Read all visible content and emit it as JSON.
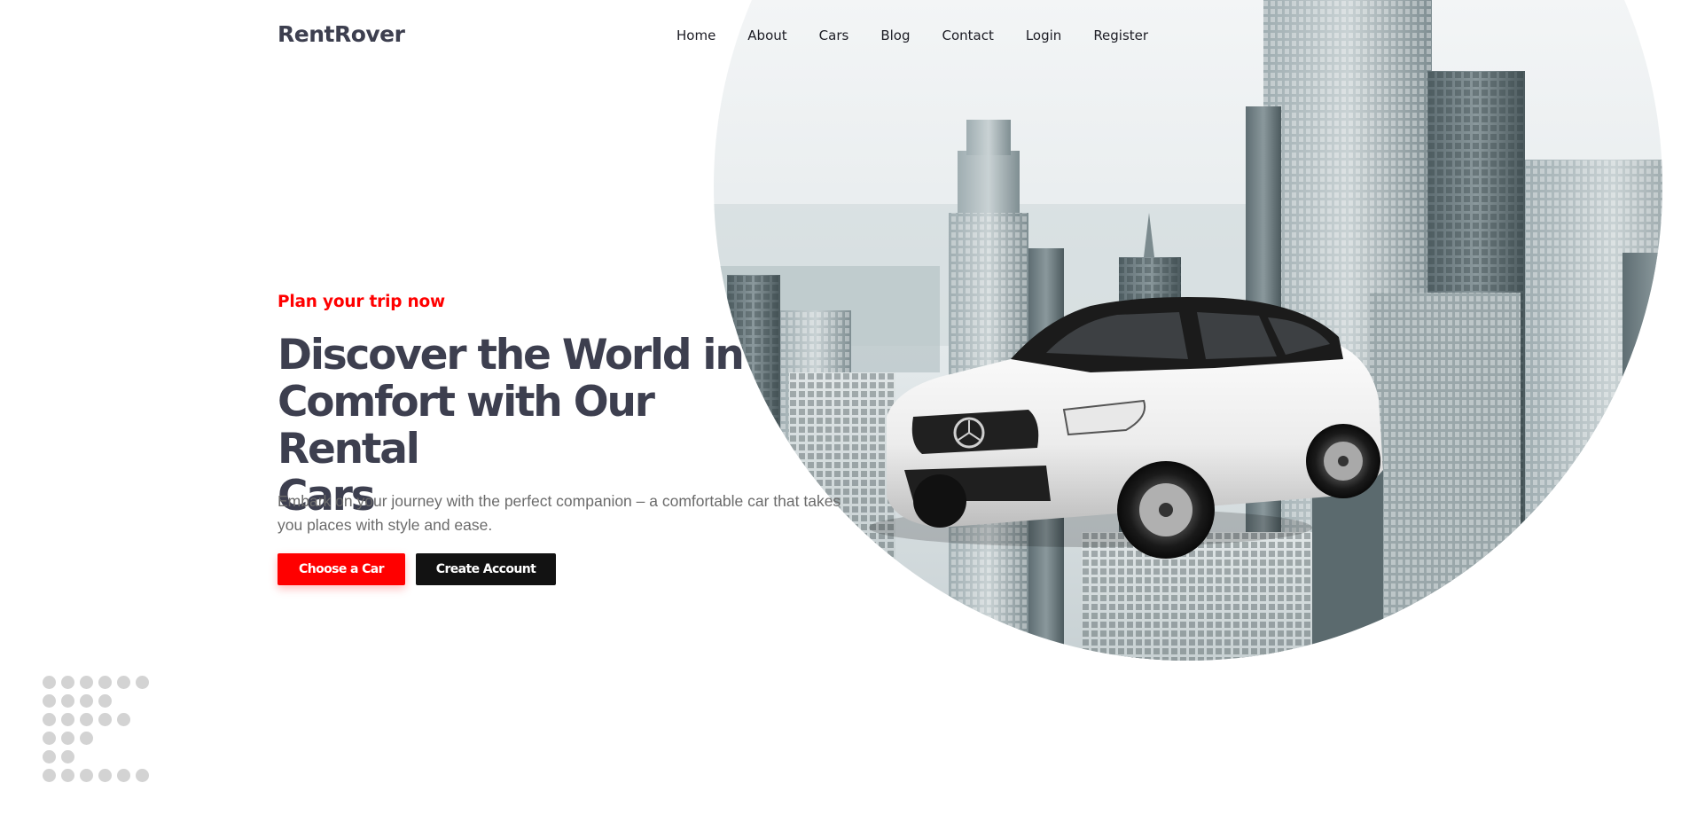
{
  "brand": {
    "name": "RentRover"
  },
  "nav": {
    "items": [
      "Home",
      "About",
      "Cars",
      "Blog",
      "Contact",
      "Login",
      "Register"
    ]
  },
  "hero": {
    "tagline": "Plan your trip now",
    "headline_lines": [
      "Discover the World in",
      "Comfort with Our Rental",
      "Cars"
    ],
    "description": "Embark on your journey with the perfect companion – a comfortable car that takes you places with style and ease.",
    "primary_button": "Choose a Car",
    "secondary_button": "Create Account"
  },
  "colors": {
    "accent": "#ff0000",
    "heading": "#3d3f4f",
    "dark_button": "#121212",
    "dot": "#d3d3d3"
  },
  "icons": {
    "hero_image": "city-skyline-with-white-suv",
    "decoration": "dot-grid-pattern"
  }
}
